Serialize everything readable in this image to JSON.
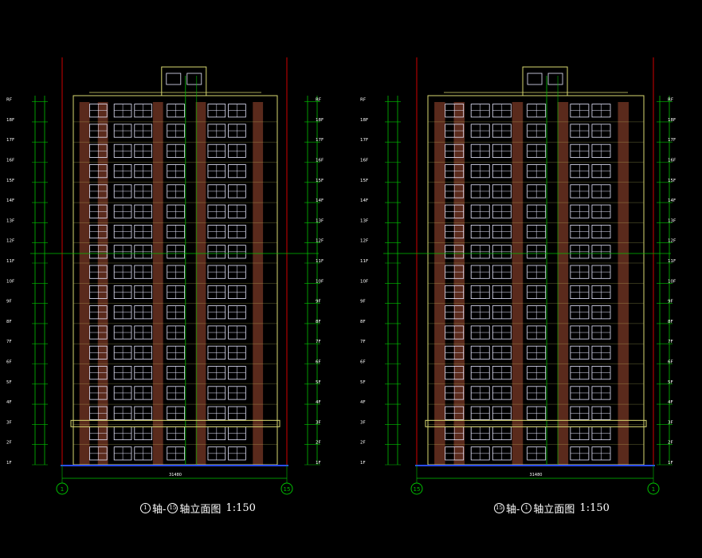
{
  "drawings": [
    {
      "id": "left",
      "title": {
        "start_axis": "1",
        "mid": "轴-",
        "end_axis": "15",
        "suffix": "轴立面图",
        "scale": "1:150"
      },
      "overall_dimension": "31480",
      "bottom_axes": [
        "1",
        "15"
      ],
      "floors": [
        "1F",
        "2F",
        "3F",
        "4F",
        "5F",
        "6F",
        "7F",
        "8F",
        "9F",
        "10F",
        "11F",
        "12F",
        "13F",
        "14F",
        "15F",
        "16F",
        "17F",
        "18F",
        "RF"
      ]
    },
    {
      "id": "right",
      "title": {
        "start_axis": "15",
        "mid": "轴-",
        "end_axis": "1",
        "suffix": "轴立面图",
        "scale": "1:150"
      },
      "overall_dimension": "31480",
      "bottom_axes": [
        "15",
        "1"
      ],
      "floors": [
        "1F",
        "2F",
        "3F",
        "4F",
        "5F",
        "6F",
        "7F",
        "8F",
        "9F",
        "10F",
        "11F",
        "12F",
        "13F",
        "14F",
        "15F",
        "16F",
        "17F",
        "18F",
        "RF"
      ]
    }
  ],
  "colors": {
    "background": "#000000",
    "wall_brown": "#5a2a1c",
    "grid_green": "#00c000",
    "outline_yellow": "#d8d870",
    "window_white": "#e8e8ff",
    "ground_blue": "#2a4cff",
    "red_line": "#d00000",
    "text_white": "#ffffff"
  }
}
